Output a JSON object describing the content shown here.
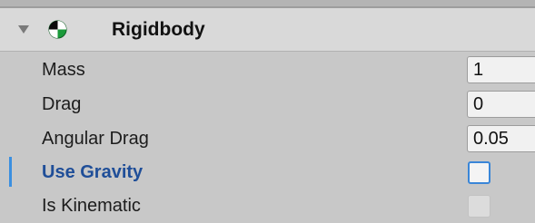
{
  "component": {
    "title": "Rigidbody",
    "icon": "rigidbody-icon"
  },
  "fields": [
    {
      "label": "Mass",
      "value": "1",
      "type": "number"
    },
    {
      "label": "Drag",
      "value": "0",
      "type": "number"
    },
    {
      "label": "Angular Drag",
      "value": "0.05",
      "type": "number"
    },
    {
      "label": "Use Gravity",
      "checked": false,
      "type": "checkbox",
      "focused": true
    },
    {
      "label": "Is Kinematic",
      "checked": false,
      "type": "checkbox",
      "enabled": false
    }
  ],
  "colors": {
    "panel_bg": "#c8c8c8",
    "header_bg": "#d9d9d9",
    "accent": "#3b8fe0",
    "active_label": "#1f4e98",
    "icon_green": "#1a9a3a"
  }
}
